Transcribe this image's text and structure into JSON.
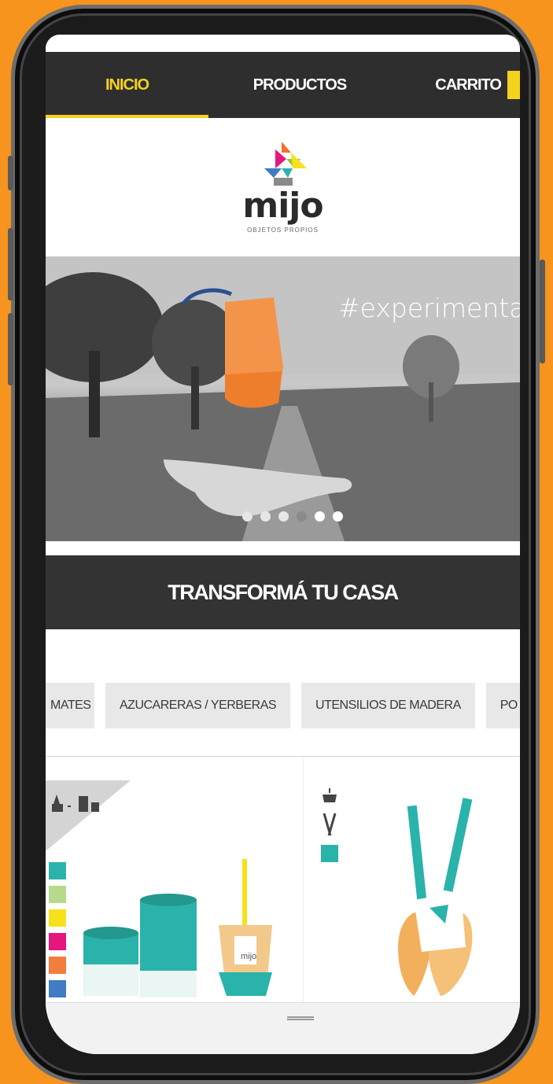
{
  "nav": {
    "tabs": [
      {
        "label": "INICIO",
        "active": true
      },
      {
        "label": "PRODUCTOS",
        "active": false
      },
      {
        "label": "CARRITO",
        "active": false
      }
    ]
  },
  "logo": {
    "wordmark": "mijo",
    "tagline": "OBJETOS PROPIOS"
  },
  "hero": {
    "caption": "#experimenta",
    "slides_total": 6,
    "active_slide": 4
  },
  "banner": {
    "title": "TRANSFORMÁ TU CASA"
  },
  "categories": [
    "MATES",
    "AZUCARERAS / YERBERAS",
    "UTENSILIOS DE MADERA",
    "PO"
  ],
  "product_card": {
    "label": "mijo"
  },
  "colors": {
    "background": "#f7941d",
    "nav_bg": "#2e2e2e",
    "accent": "#f5d21e",
    "banner_bg": "#333333",
    "swatches": [
      "#2ab3aa",
      "#b7d98b",
      "#f6e11b",
      "#e5177e",
      "#f47c3c",
      "#3f7cc4"
    ]
  },
  "icons": [
    "mate-and-tins-icon",
    "sugar-bowl-icon",
    "utensils-icon",
    "chevron-icon"
  ]
}
